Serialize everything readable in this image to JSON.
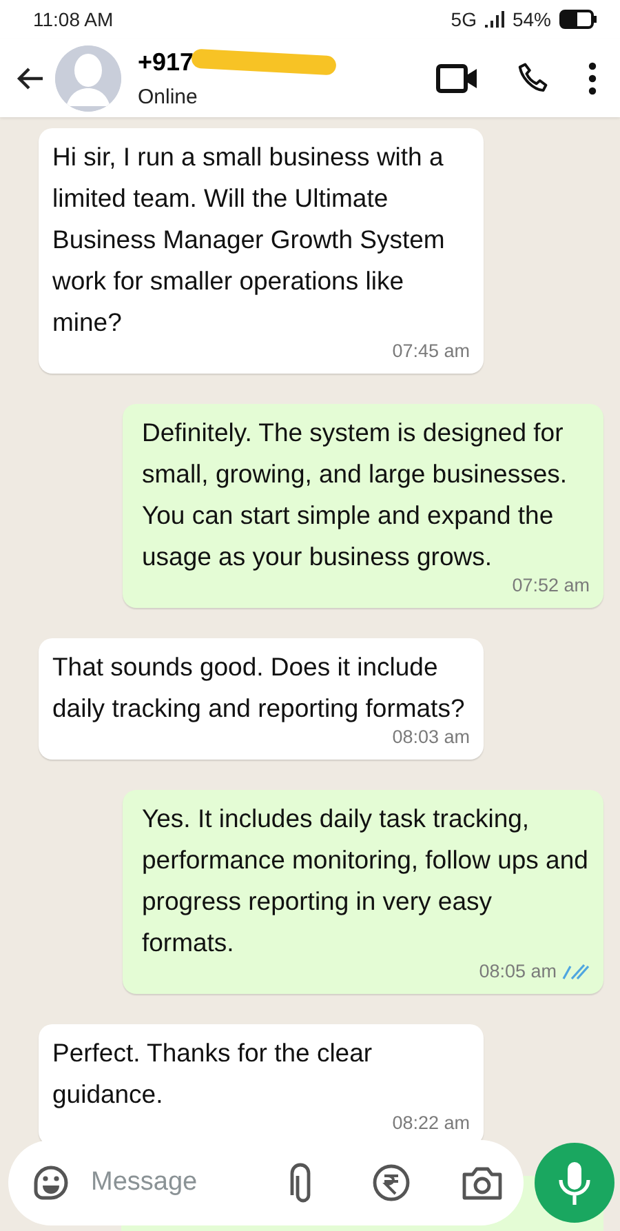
{
  "status_bar": {
    "time": "11:08 AM",
    "network": "5G",
    "battery": "54%"
  },
  "header": {
    "contact": "+917",
    "presence": "Online"
  },
  "messages": [
    {
      "kind": "incoming",
      "text": "Hi sir, I run a small business with a limited team. Will the Ultimate Business Manager Growth System work for smaller operations like mine?",
      "time": "07:45 am"
    },
    {
      "kind": "outgoing",
      "text": "Definitely. The system is designed for small, growing, and large businesses. You can start simple and expand the usage as your business grows.",
      "time": "07:52 am",
      "read": false
    },
    {
      "kind": "incoming",
      "text": "That sounds good. Does it include daily tracking and reporting formats?",
      "time": "08:03 am"
    },
    {
      "kind": "outgoing",
      "text": "Yes. It includes daily task tracking, performance monitoring, follow ups and progress reporting in very easy formats.",
      "time": "08:05 am",
      "read": true
    },
    {
      "kind": "incoming",
      "text": "Perfect. Thanks for the clear guidance.",
      "time": "08:22 am"
    }
  ],
  "composer": {
    "placeholder": "Message"
  }
}
